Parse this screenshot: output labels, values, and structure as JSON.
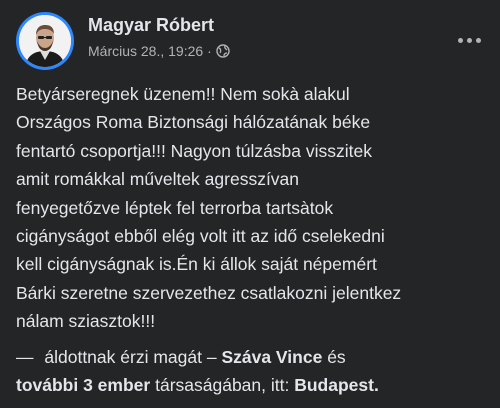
{
  "post": {
    "author": "Magyar Róbert",
    "date": "Március 28., 19:26",
    "separator": "·",
    "privacy_icon": "globe-icon",
    "more_icon": "more-options-icon",
    "body_lines": [
      "Betyárseregnek üzenem!! Nem sokà alakul",
      "Országos Roma Biztonsági hálózatának béke",
      "fentartó csoportja!!! Nagyon túlzásba visszitek",
      "amit romákkal műveltek agresszívan",
      "fenyegetőzve léptek fel terrorba tartsàtok",
      "cigányságot ebből elég volt itt az idő cselekedni",
      "kell cigányságnak is.Én ki állok saját népemért",
      "Bárki szeretne szervezethez csatlakozni jelentkez",
      "nálam sziasztok!!!"
    ],
    "feeling": {
      "dash": "—",
      "text": "áldottnak érzi magát",
      "dash2": "–",
      "tagged_person": "Száva Vince",
      "and": "és",
      "others": "további 3 ember",
      "with": "társaságában, itt:",
      "location": "Budapest",
      "end": "."
    }
  },
  "colors": {
    "background": "#242526",
    "primary_text": "#e4e6eb",
    "secondary_text": "#b0b3b8",
    "avatar_ring": "#2d88ff"
  }
}
